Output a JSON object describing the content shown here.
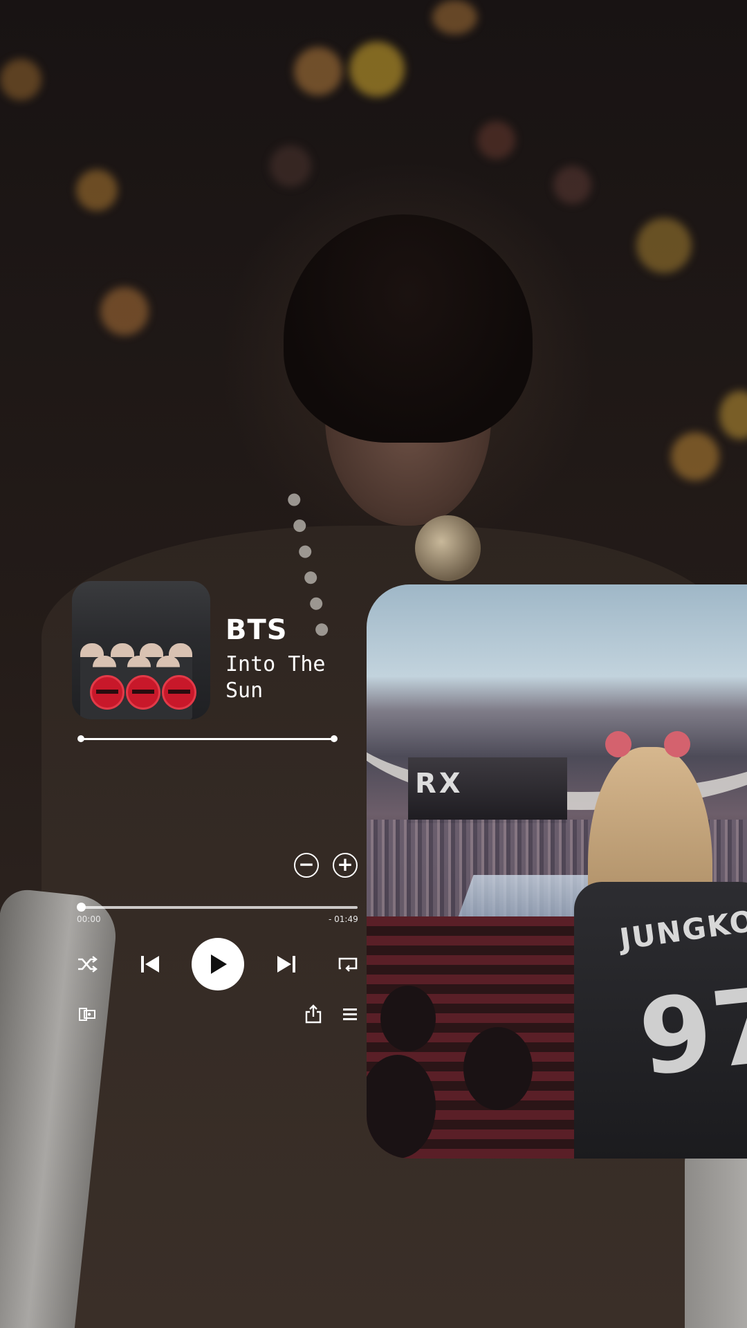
{
  "player": {
    "artist": "BTS",
    "song_title": "Into The Sun",
    "time_elapsed": "00:00",
    "time_remaining": "- 01:49",
    "progress": 0.0,
    "zoom_out_symbol": "−",
    "zoom_in_symbol": "+"
  },
  "controls": {
    "icons": [
      "shuffle-icon",
      "previous-icon",
      "play-icon",
      "next-icon",
      "repeat-icon",
      "cast-icon",
      "share-icon",
      "queue-icon"
    ]
  },
  "colors": {
    "control_white": "#ffffff",
    "album_logo_red": "#c8182a"
  },
  "background_photo": {
    "jersey_name": "JUNGKOOK",
    "jersey_number": "97",
    "stage_screen": "RX"
  }
}
